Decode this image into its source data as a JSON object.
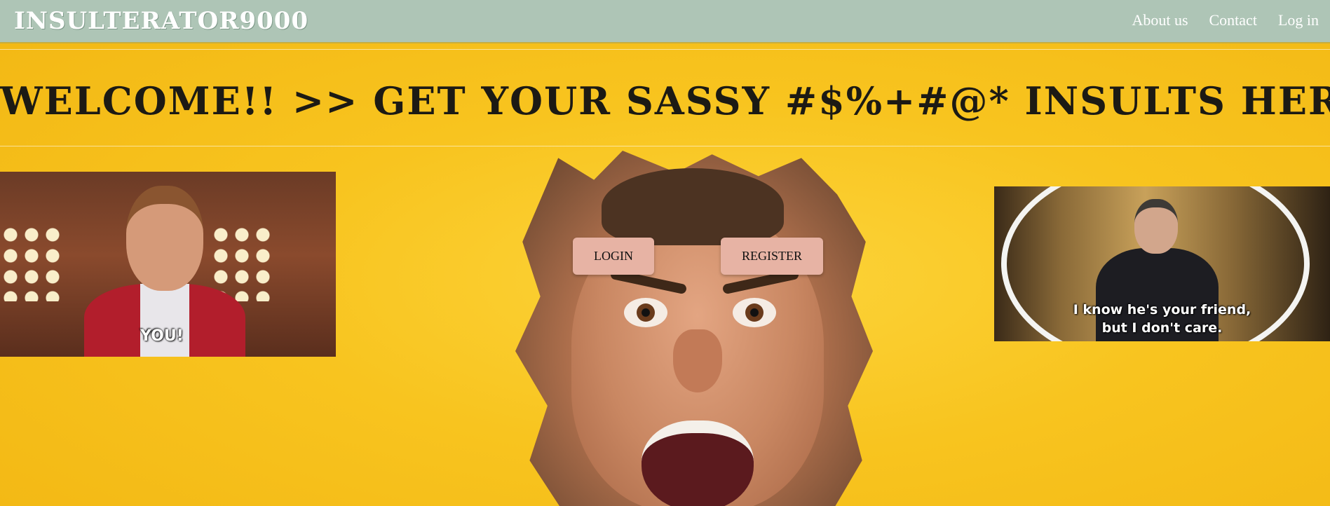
{
  "brand": {
    "name": "INSULTERATOR9000"
  },
  "nav": {
    "items": [
      {
        "label": "About us"
      },
      {
        "label": "Contact"
      },
      {
        "label": "Log in"
      }
    ]
  },
  "hero": {
    "title": "WELCOME!! >> GET YOUR SASSY #$%+#@* INSULTS HERE!"
  },
  "actions": {
    "login_label": "LOGIN",
    "register_label": "REGISTER"
  },
  "gifs": {
    "left_caption": "YOU!",
    "right_caption_line1": "I know he's your friend,",
    "right_caption_line2": "but I don't care."
  },
  "colors": {
    "navbar": "#aec5b6",
    "background": "#f8c21f",
    "button": "#e7b3a4"
  }
}
